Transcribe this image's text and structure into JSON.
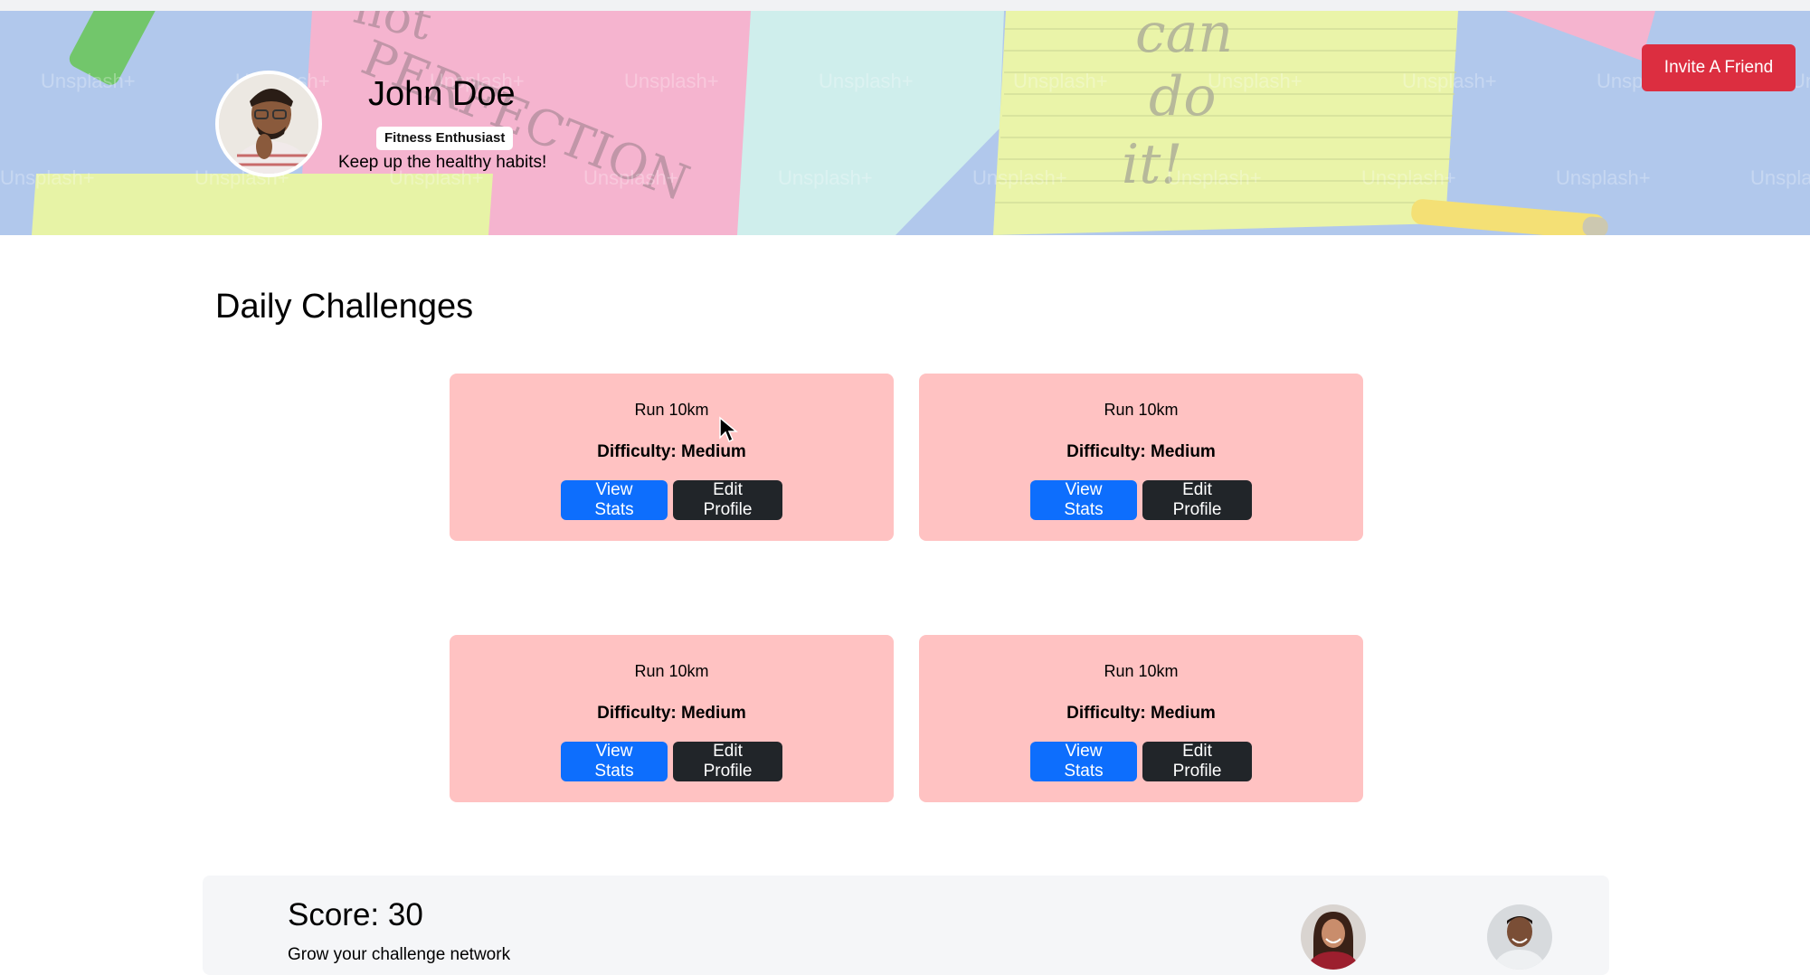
{
  "profile": {
    "name": "John Doe",
    "badge": "Fitness Enthusiast",
    "tagline": "Keep up the healthy habits!"
  },
  "banner": {
    "invite_label": "Invite A Friend",
    "watermark": "Unsplash+"
  },
  "challenges": {
    "heading": "Daily Challenges",
    "items": [
      {
        "title": "Run 10km",
        "difficulty": "Difficulty: Medium",
        "primary_label": "View Stats",
        "secondary_label": "Edit Profile"
      },
      {
        "title": "Run 10km",
        "difficulty": "Difficulty: Medium",
        "primary_label": "View Stats",
        "secondary_label": "Edit Profile"
      },
      {
        "title": "Run 10km",
        "difficulty": "Difficulty: Medium",
        "primary_label": "View Stats",
        "secondary_label": "Edit Profile"
      },
      {
        "title": "Run 10km",
        "difficulty": "Difficulty: Medium",
        "primary_label": "View Stats",
        "secondary_label": "Edit Profile"
      }
    ]
  },
  "score": {
    "label": "Score: 30",
    "subtitle": "Grow your challenge network"
  },
  "colors": {
    "invite": "#dc2e40",
    "card_bg": "#ffc2c2",
    "primary": "#0d6efd",
    "dark": "#212529"
  }
}
